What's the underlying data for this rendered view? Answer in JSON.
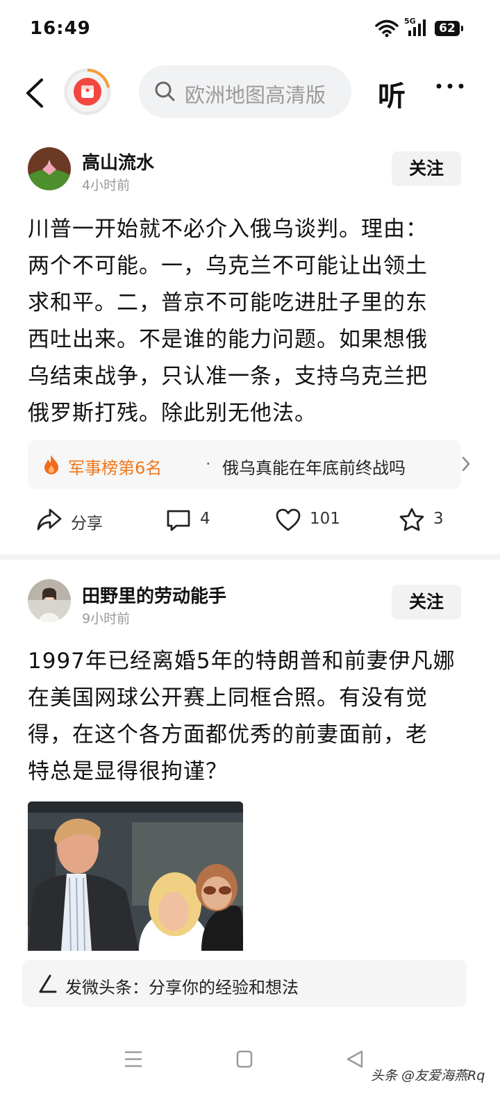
{
  "status_bar": {
    "time": "16:49",
    "network": "5G",
    "battery": "62"
  },
  "top_bar": {
    "search_placeholder": "欧洲地图高清版",
    "listen_label": "听"
  },
  "posts": [
    {
      "author": "高山流水",
      "time_ago": "4小时前",
      "follow_label": "关注",
      "content_lines": [
        "川普一开始就不必介入俄乌谈判。理由：",
        "两个不可能。一，乌克兰不可能让出领土",
        "求和平。二，普京不可能吃进肚子里的东",
        "西吐出来。不是谁的能力问题。如果想俄",
        "乌结束战争，只认准一条，支持乌克兰把",
        "俄罗斯打残。除此别无他法。"
      ],
      "topic": {
        "rank": "军事榜第6名",
        "separator": "·",
        "title": "俄乌真能在年底前终战吗"
      },
      "actions": {
        "share": "分享",
        "comments": "4",
        "likes": "101",
        "favorites": "3"
      }
    },
    {
      "author": "田野里的劳动能手",
      "time_ago": "9小时前",
      "follow_label": "关注",
      "content_lines": [
        "1997年已经离婚5年的特朗普和前妻伊凡娜",
        "在美国网球公开赛上同框合照。有没有觉",
        "得，在这个各方面都优秀的前妻面前，老",
        "特总是显得很拘谨？"
      ]
    }
  ],
  "compose": {
    "placeholder": "发微头条：分享你的经验和想法"
  },
  "watermark": "头条 @友爱海燕Rq"
}
